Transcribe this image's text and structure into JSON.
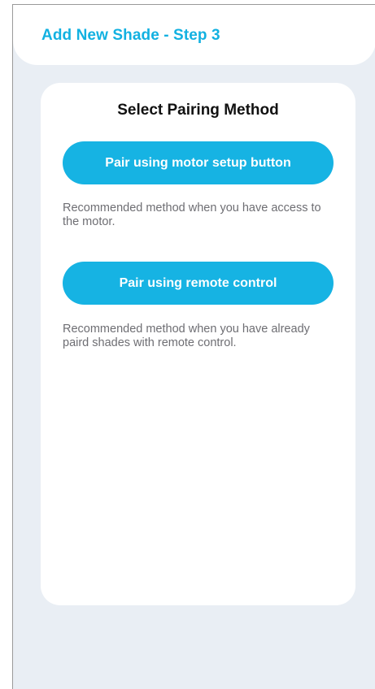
{
  "header": {
    "title": "Add New Shade - Step 3"
  },
  "card": {
    "title": "Select Pairing Method",
    "options": [
      {
        "button_label": "Pair using motor setup button",
        "description": "Recommended method when you have access to the motor."
      },
      {
        "button_label": "Pair using remote control",
        "description": "Recommended method when you have already paird shades with remote control."
      }
    ]
  },
  "colors": {
    "accent": "#16b3e3",
    "title_accent": "#12b1e1",
    "background": "#e9eef4",
    "surface": "#ffffff",
    "description_text": "#6e6e73"
  }
}
